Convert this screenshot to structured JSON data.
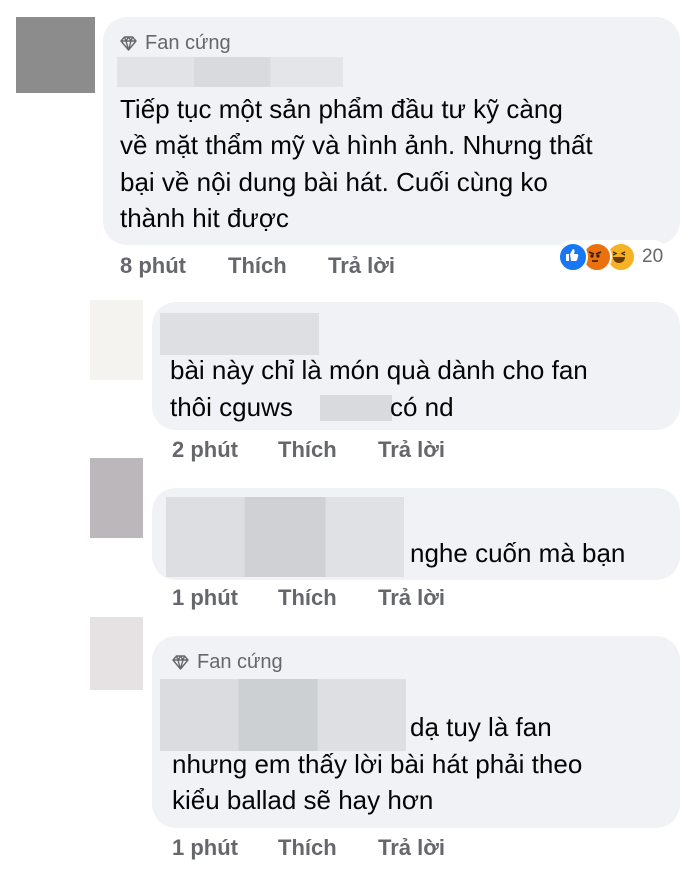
{
  "comments": [
    {
      "badge": "Fan cứng",
      "lines": [
        "Tiếp tục một sản phẩm đầu tư kỹ càng",
        "về mặt thẩm mỹ và hình ảnh. Nhưng thất",
        "bại về nội dung bài hát. Cuối cùng ko",
        "thành hit được"
      ],
      "time": "8 phút",
      "like": "Thích",
      "reply": "Trả lời",
      "reaction_count": "20",
      "reactions": [
        "like-reaction-icon",
        "angry-reaction-icon",
        "haha-reaction-icon"
      ]
    },
    {
      "lines": [
        "bài này chỉ là món quà dành cho fan",
        "thôi cguws",
        "có nd"
      ],
      "time": "2 phút",
      "like": "Thích",
      "reply": "Trả lời"
    },
    {
      "lines": [
        "nghe cuốn mà bạn"
      ],
      "time": "1 phút",
      "like": "Thích",
      "reply": "Trả lời"
    },
    {
      "badge": "Fan cứng",
      "lines": [
        "dạ tuy là fan",
        "nhưng em thấy lời bài hát phải theo",
        "kiểu ballad sẽ hay hơn"
      ],
      "time": "1 phút",
      "like": "Thích",
      "reply": "Trả lời"
    }
  ],
  "colors": {
    "bubble": "#f0f2f5",
    "meta": "#65676b",
    "like_blue": "#1877f2",
    "angry": "#e9710f",
    "haha": "#f7b125"
  }
}
